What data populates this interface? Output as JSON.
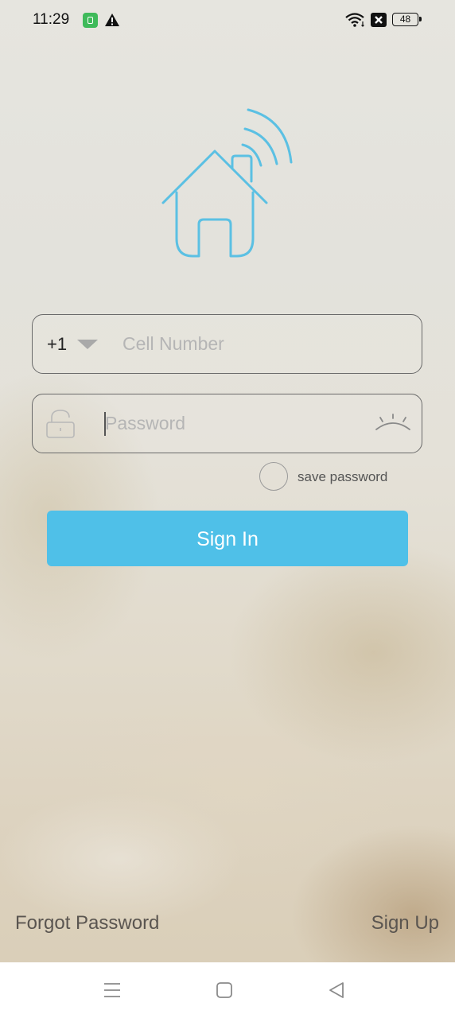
{
  "status_bar": {
    "time": "11:29",
    "battery": "48",
    "icons": [
      "app-notification-icon",
      "warning-icon",
      "wifi-icon",
      "no-sim-icon",
      "battery-icon"
    ]
  },
  "logo": {
    "icon": "smart-home-wifi-icon",
    "color": "#5bc0e3"
  },
  "login": {
    "country_code": "+1",
    "phone_placeholder": "Cell Number",
    "password_placeholder": "Password",
    "save_password_label": "save password",
    "save_password_checked": false,
    "sign_in_label": "Sign In",
    "accent_color": "#4fc0e8"
  },
  "links": {
    "forgot_password": "Forgot Password",
    "sign_up": "Sign Up"
  },
  "nav_bar": {
    "icons": [
      "menu-icon",
      "home-icon",
      "back-icon"
    ]
  }
}
